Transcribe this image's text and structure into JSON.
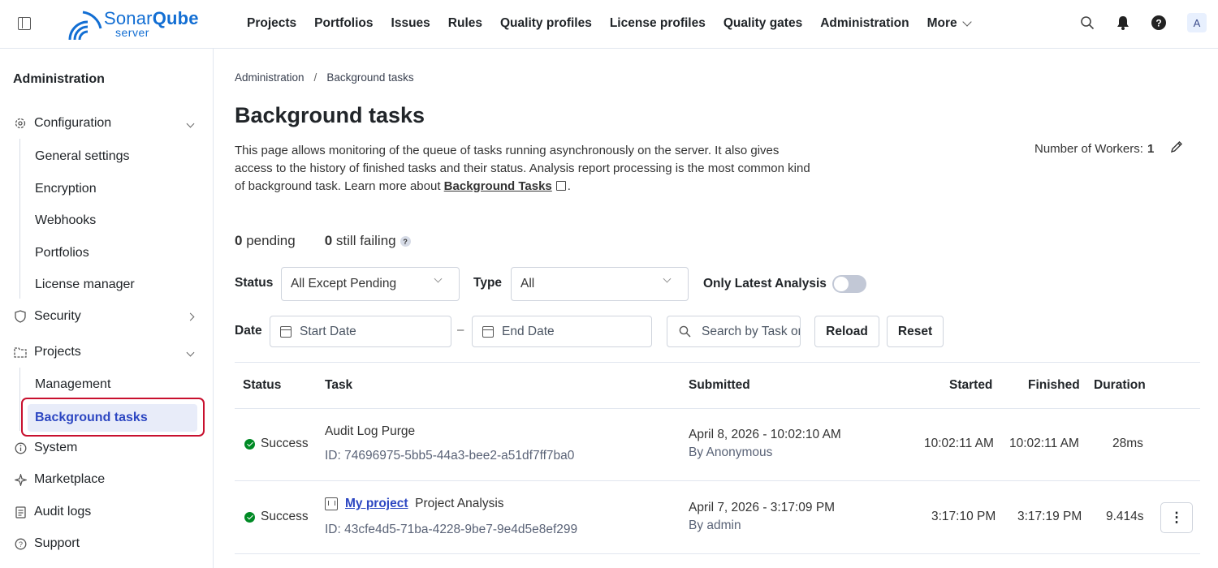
{
  "brand": {
    "name_light": "Sonar",
    "name_bold": "Qube",
    "sub": "server",
    "color": "#126ed3"
  },
  "nav": [
    "Projects",
    "Portfolios",
    "Issues",
    "Rules",
    "Quality profiles",
    "License profiles",
    "Quality gates",
    "Administration",
    "More"
  ],
  "user_initial": "A",
  "sidebar": {
    "title": "Administration",
    "configuration": "Configuration",
    "config_items": [
      "General settings",
      "Encryption",
      "Webhooks",
      "Portfolios",
      "License manager"
    ],
    "security": "Security",
    "projects": "Projects",
    "project_items": [
      "Management",
      "Background tasks"
    ],
    "system": "System",
    "marketplace": "Marketplace",
    "audit_logs": "Audit logs",
    "support": "Support"
  },
  "breadcrumb": {
    "parent": "Administration",
    "separator": "/",
    "current": "Background tasks"
  },
  "page": {
    "title": "Background tasks",
    "description": "This page allows monitoring of the queue of tasks running asynchronously on the server. It also gives access to the history of finished tasks and their status. Analysis report processing is the most common kind of background task. Learn more about",
    "link_text": "Background Tasks",
    "workers_label": "Number of Workers:",
    "workers_value": "1"
  },
  "stats": {
    "pending_count": "0",
    "pending_label": "pending",
    "failing_count": "0",
    "failing_label": "still failing",
    "help": "?"
  },
  "filters": {
    "status_label": "Status",
    "status_value": "All Except Pending",
    "type_label": "Type",
    "type_value": "All",
    "latest_label": "Only Latest Analysis",
    "date_label": "Date",
    "start_placeholder": "Start Date",
    "end_placeholder": "End Date",
    "date_separator": "–",
    "search_placeholder": "Search by Task or Component",
    "reload": "Reload",
    "reset": "Reset"
  },
  "table": {
    "headers": [
      "Status",
      "Task",
      "Submitted",
      "Started",
      "Finished",
      "Duration"
    ],
    "rows": [
      {
        "status": "Success",
        "task": "Audit Log Purge",
        "project": "",
        "id": "ID: 74696975-5bb5-44a3-bee2-a51df7ff7ba0",
        "submitted": "April 8, 2026 - 10:02:10 AM",
        "by": "By Anonymous",
        "started": "10:02:11 AM",
        "finished": "10:02:11 AM",
        "duration": "28ms"
      },
      {
        "status": "Success",
        "task": "Project Analysis",
        "project": "My project",
        "id": "ID: 43cfe4d5-71ba-4228-9be7-9e4d5e8ef299",
        "submitted": "April 7, 2026 - 3:17:09 PM",
        "by": "By admin",
        "started": "3:17:10 PM",
        "finished": "3:17:19 PM",
        "duration": "9.414s"
      }
    ]
  },
  "colors": {
    "accent": "#2d47c2",
    "success": "#008a25",
    "highlight_border": "#c8102e",
    "active_bg": "#e8ecf9"
  }
}
